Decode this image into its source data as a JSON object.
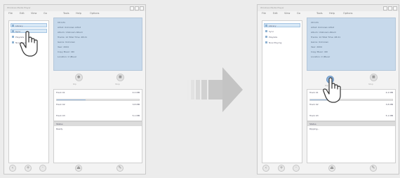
{
  "windows": [
    {
      "title": "Windows Media Player",
      "menu": [
        "File",
        "Edit",
        "View",
        "Go",
        "Tools",
        "Help",
        "Options"
      ],
      "sidebar": [
        "Library",
        "Sync",
        "Playlists",
        "Now Playing"
      ],
      "info_lines": [
        "CD Info",
        "Artist: Unknown Artist",
        "Album: Unknown Album",
        "Tracks: 12   Total Time: 48:21",
        "Genre: Unknown",
        "Year: 2004",
        "Copy Music: ON",
        "Location: C:\\Music"
      ],
      "controls": [
        "Rip",
        "Stop"
      ],
      "track": {
        "title": "Track 01",
        "size": "4.2 MB"
      },
      "track2": {
        "title": "Track 02",
        "size": "3.8 MB"
      },
      "track3": {
        "title": "Track 03",
        "size": "5.1 MB"
      },
      "log": [
        "Status",
        "Ready"
      ],
      "progress": 0.35
    },
    {
      "title": "Windows Media Player",
      "menu": [
        "File",
        "Edit",
        "View",
        "Go",
        "Tools",
        "Help",
        "Options"
      ],
      "sidebar": [
        "Library",
        "Sync",
        "Playlists",
        "Now Playing"
      ],
      "info_lines": [
        "CD Info",
        "Artist: Unknown Artist",
        "Album: Unknown Album",
        "Tracks: 12   Total Time: 48:21",
        "Genre: Unknown",
        "Year: 2004",
        "Copy Music: ON",
        "Location: C:\\Music"
      ],
      "controls": [
        "Rip",
        "Stop"
      ],
      "track": {
        "title": "Track 01",
        "size": "4.2 MB"
      },
      "track2": {
        "title": "Track 02",
        "size": "3.8 MB"
      },
      "track3": {
        "title": "Track 03",
        "size": "5.1 MB"
      },
      "log": [
        "Status",
        "Ripping..."
      ],
      "progress": 0.35
    }
  ],
  "icons": {
    "pointer": "hand-pointer-icon",
    "arrow": "right-arrow-icon"
  },
  "colors": {
    "info_panel": "#c7d9eb",
    "selection": "#d8e8f6",
    "active_button": "#8db4de",
    "arrow": "#c4c4c4"
  }
}
